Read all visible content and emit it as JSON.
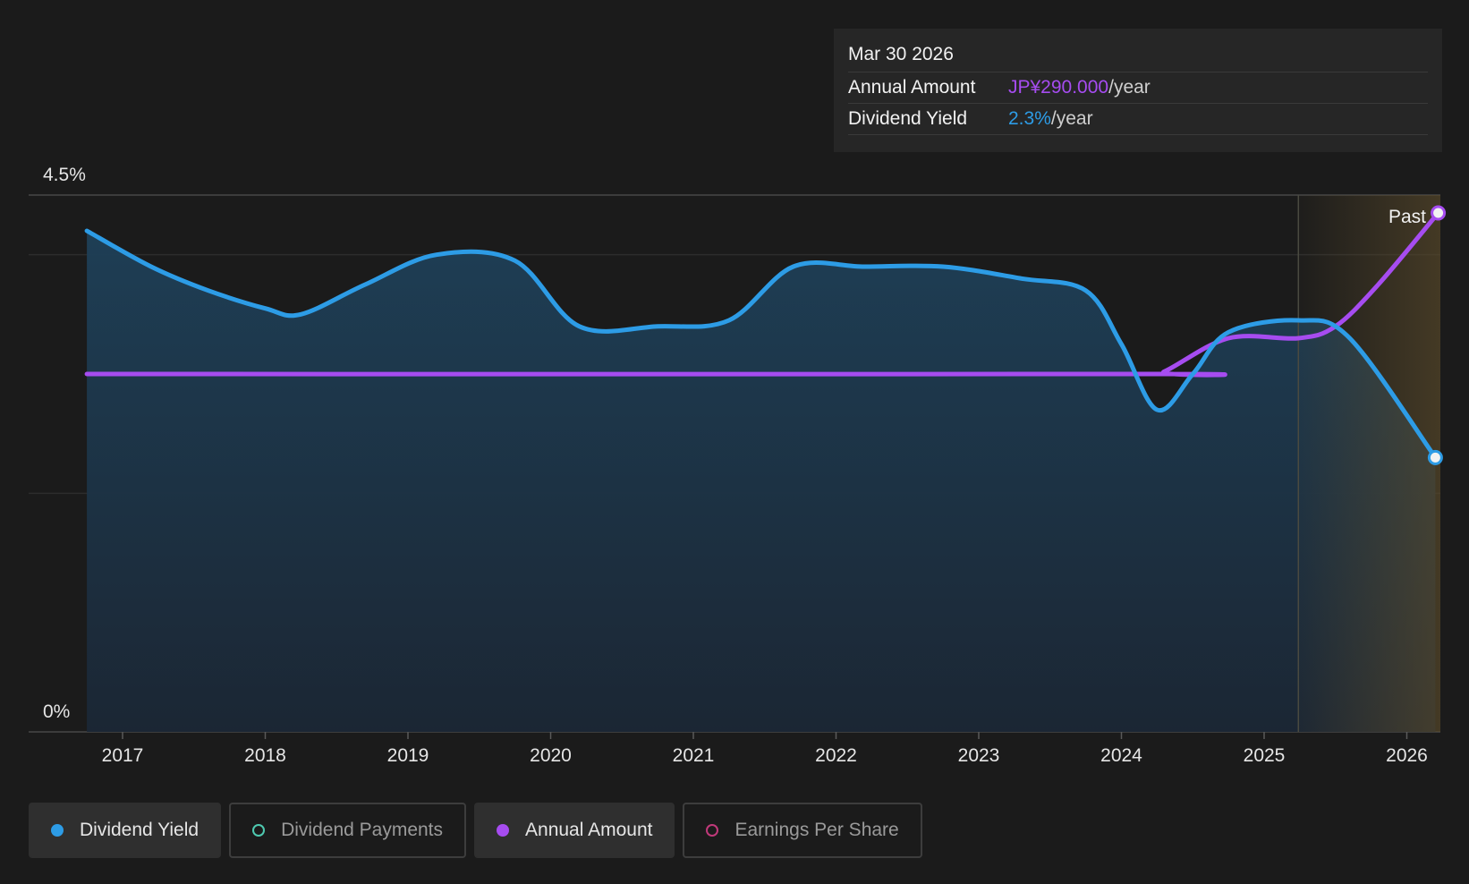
{
  "tooltip": {
    "date": "Mar 30 2026",
    "rows": [
      {
        "label": "Annual Amount",
        "value": "JP¥290.000",
        "unit": "/year"
      },
      {
        "label": "Dividend Yield",
        "value": "2.3%",
        "unit": "/year"
      }
    ]
  },
  "legend": [
    {
      "label": "Dividend Yield",
      "color": "#2d9ce6",
      "active": true,
      "filled": true
    },
    {
      "label": "Dividend Payments",
      "color": "#4ec9b0",
      "active": false,
      "filled": false
    },
    {
      "label": "Annual Amount",
      "color": "#a64cf0",
      "active": true,
      "filled": true
    },
    {
      "label": "Earnings Per Share",
      "color": "#c0397a",
      "active": false,
      "filled": false
    }
  ],
  "chart_data": {
    "type": "line",
    "ylim": [
      0,
      4.5
    ],
    "y_top_label": "4.5%",
    "y_bottom_label": "0%",
    "x_ticks": [
      "2017",
      "2018",
      "2019",
      "2020",
      "2021",
      "2022",
      "2023",
      "2024",
      "2025",
      "2026"
    ],
    "past_label": "Past",
    "past_start": 2025.24,
    "series": [
      {
        "name": "Dividend Yield",
        "unit": "%",
        "color": "#2d9ce6",
        "points": [
          [
            2016.75,
            4.2
          ],
          [
            2017.2,
            3.9
          ],
          [
            2017.6,
            3.7
          ],
          [
            2018.0,
            3.55
          ],
          [
            2018.25,
            3.5
          ],
          [
            2018.7,
            3.75
          ],
          [
            2019.2,
            4.0
          ],
          [
            2019.75,
            3.95
          ],
          [
            2020.2,
            3.4
          ],
          [
            2020.75,
            3.4
          ],
          [
            2021.25,
            3.45
          ],
          [
            2021.7,
            3.9
          ],
          [
            2022.2,
            3.9
          ],
          [
            2022.75,
            3.9
          ],
          [
            2023.3,
            3.8
          ],
          [
            2023.75,
            3.7
          ],
          [
            2024.0,
            3.25
          ],
          [
            2024.25,
            2.7
          ],
          [
            2024.5,
            3.0
          ],
          [
            2024.75,
            3.35
          ],
          [
            2025.24,
            3.45
          ],
          [
            2025.6,
            3.3
          ],
          [
            2026.2,
            2.3
          ]
        ]
      },
      {
        "name": "Annual Amount",
        "unit": "JP¥",
        "color": "#a64cf0",
        "points": [
          [
            2016.75,
            3.0
          ],
          [
            2024.15,
            3.0
          ],
          [
            2024.3,
            3.02
          ],
          [
            2024.75,
            3.3
          ],
          [
            2025.24,
            3.3
          ],
          [
            2025.5,
            3.4
          ],
          [
            2025.8,
            3.75
          ],
          [
            2026.22,
            4.35
          ]
        ]
      }
    ]
  }
}
